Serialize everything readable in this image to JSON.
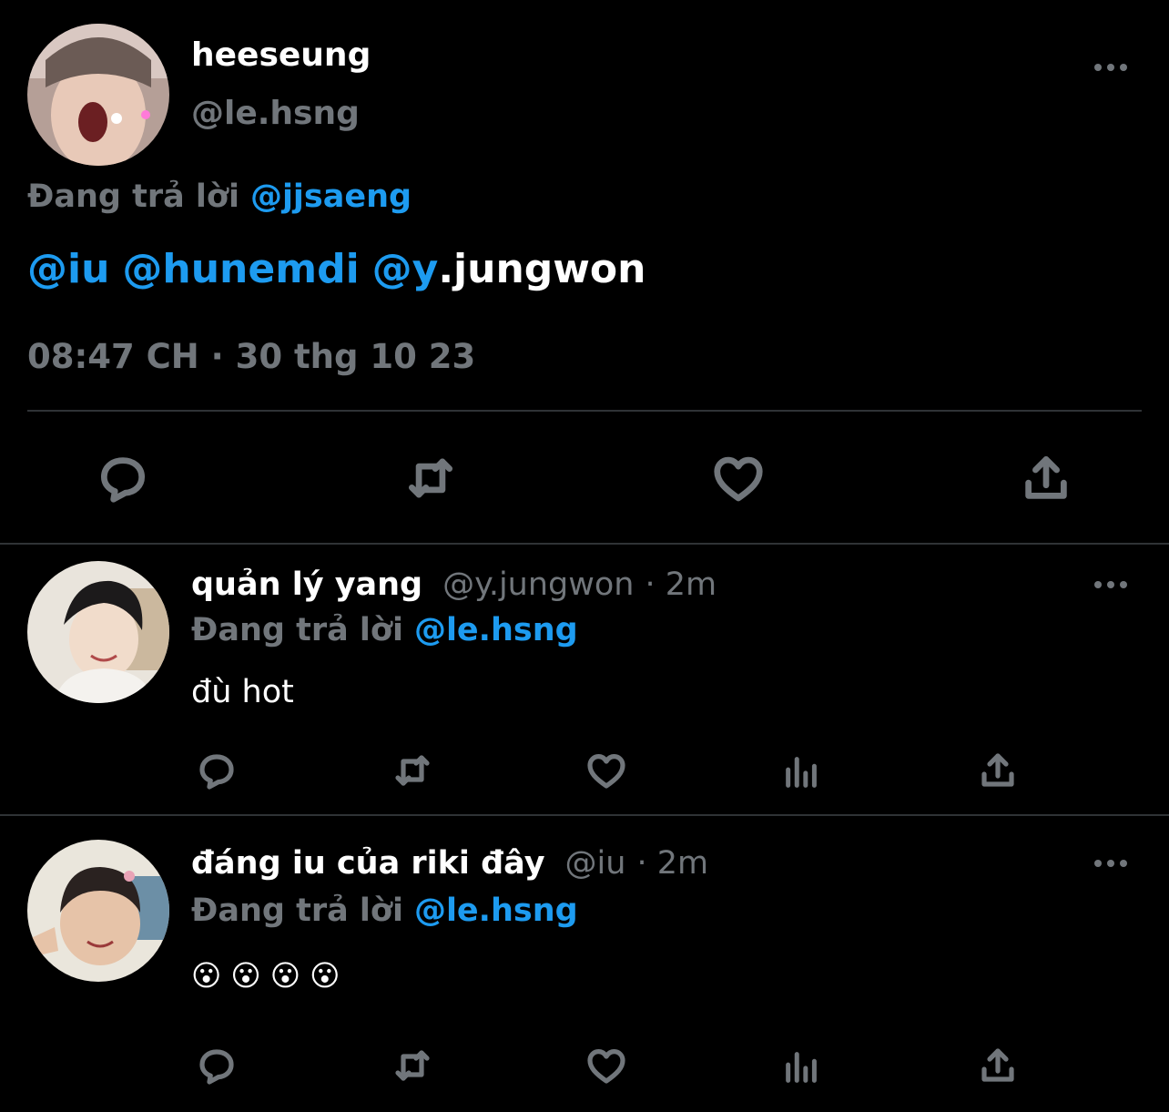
{
  "main_tweet": {
    "author_name": "heeseung",
    "handle": "@le.hsng",
    "replying_prefix": "Đang trả lời",
    "replying_to": "@jjsaeng",
    "text_mentions": [
      "@iu",
      "@hunemdi",
      "@y"
    ],
    "text_tail": ".jungwon",
    "timestamp": "08:47 CH · 30 thg 10 23"
  },
  "replies": [
    {
      "author_name": "quản lý yang",
      "handle": "@y.jungwon",
      "time": "· 2m",
      "replying_prefix": "Đang trả lời",
      "replying_to": "@le.hsng",
      "text": "đù hot"
    },
    {
      "author_name": "đáng iu của riki đây",
      "handle": "@iu",
      "time": "· 2m",
      "replying_prefix": "Đang trả lời",
      "replying_to": "@le.hsng",
      "text": "😮😮😮😮"
    }
  ],
  "colors": {
    "background": "#000000",
    "accent": "#1d9bf0",
    "muted": "#71767b",
    "text": "#e7e9ea"
  },
  "icons": [
    "reply-icon",
    "retweet-icon",
    "like-icon",
    "views-icon",
    "share-icon",
    "more-icon"
  ]
}
